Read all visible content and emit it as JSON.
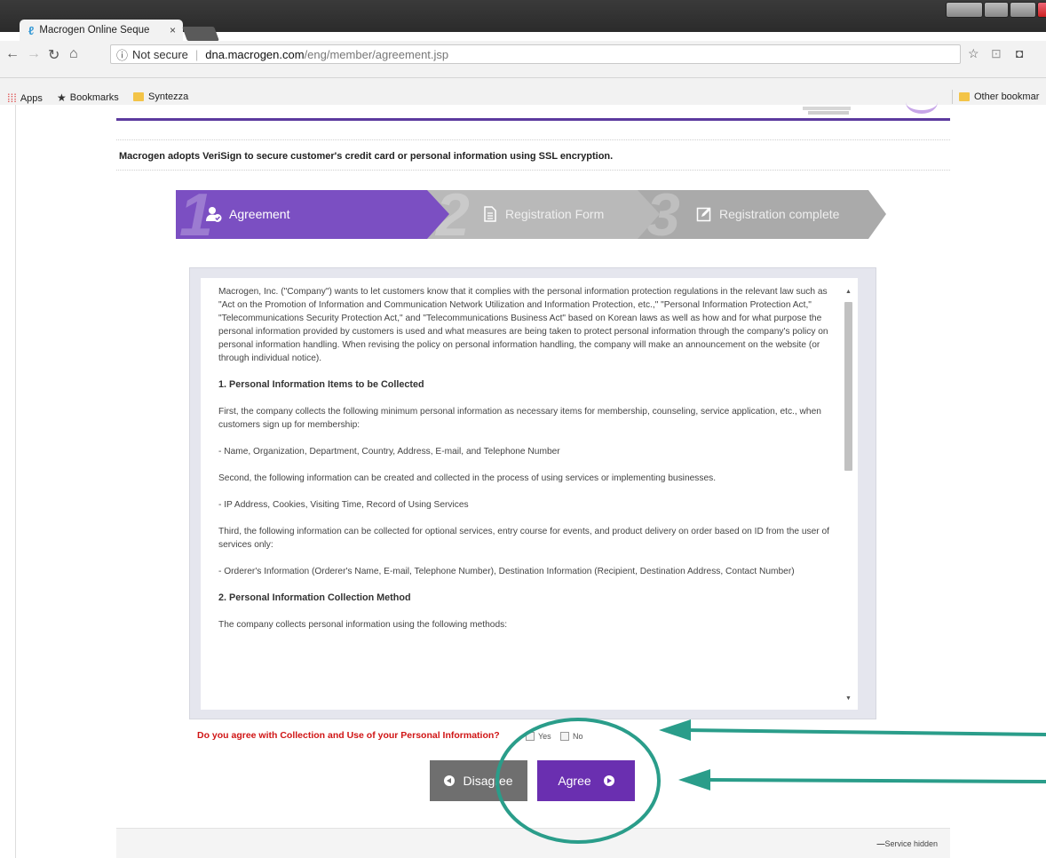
{
  "browser": {
    "tab_title": "Macrogen Online Seque",
    "tab_close": "×",
    "security_label": "Not secure",
    "url_domain": "dna.macrogen.com",
    "url_path": "/eng/member/agreement.jsp",
    "bookmarks": [
      {
        "label": "Apps",
        "icon": "apps-grid-icon"
      },
      {
        "label": "Bookmarks",
        "icon": "star-icon"
      },
      {
        "label": "Syntezza",
        "icon": "folder-icon"
      }
    ],
    "other_bookmarks": "Other bookmar"
  },
  "notice": "Macrogen adopts VeriSign to secure customer's credit card or personal information using SSL encryption.",
  "steps": [
    {
      "number": "1",
      "label": "Agreement",
      "active": true
    },
    {
      "number": "2",
      "label": "Registration Form",
      "active": false
    },
    {
      "number": "3",
      "label": "Registration complete",
      "active": false
    }
  ],
  "agreement": {
    "paragraphs": [
      "Macrogen, Inc. (\"Company\") wants to let customers know that it complies with the personal information protection regulations in the relevant law such as \"Act on the Promotion of Information and Communication Network Utilization and Information Protection, etc.,\" \"Personal Information Protection Act,\" \"Telecommunications Security Protection Act,\" and \"Telecommunications Business Act\" based on Korean laws as well as how and for what purpose the personal information provided by customers is used and what measures are being taken to protect personal information through the company's policy on personal information handling. When revising the policy on personal information handling, the company will make an announcement on the website (or through individual notice).",
      "1. Personal Information Items to be Collected",
      "First, the company collects the following minimum personal information as necessary items for membership, counseling, service application, etc., when customers sign up for membership:",
      "- Name, Organization, Department, Country, Address, E-mail, and Telephone Number",
      "Second, the following information can be created and collected in the process of using services or implementing businesses.",
      "- IP Address, Cookies, Visiting Time, Record of Using Services",
      "Third, the following information can be collected for optional services, entry course for events, and product delivery on order based on ID from the user of services only:",
      "- Orderer's Information (Orderer's Name, E-mail, Telephone Number), Destination Information (Recipient, Destination Address, Contact Number)",
      "2. Personal Information Collection Method",
      "The company collects personal information using the following methods:"
    ]
  },
  "question": "Do you agree with Collection and Use of your Personal Information?",
  "options": {
    "yes": "Yes",
    "no": "No"
  },
  "buttons": {
    "disagree": "Disagree",
    "agree": "Agree"
  },
  "footer": {
    "service_hidden": "Service hidden"
  },
  "colors": {
    "brand_purple": "#6a2fb0",
    "step_active": "#7b4fc2",
    "annotation_teal": "#2a9d8a",
    "question_red": "#d01515"
  }
}
